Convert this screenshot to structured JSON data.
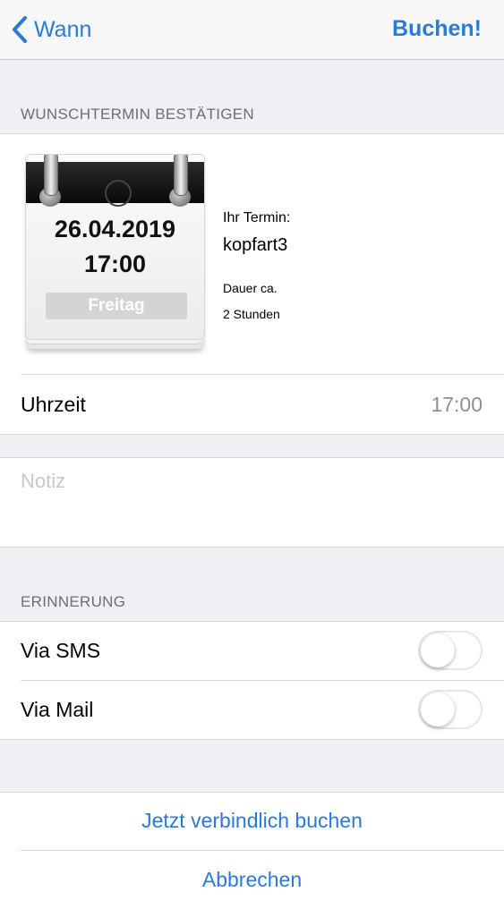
{
  "nav": {
    "back_label": "Wann",
    "action_label": "Buchen!"
  },
  "confirm_section": {
    "header": "WUNSCHTERMIN BESTÄTIGEN",
    "calendar": {
      "date": "26.04.2019",
      "time": "17:00",
      "weekday": "Freitag"
    },
    "appointment_label": "Ihr Termin:",
    "appointment_name": "kopfart3",
    "duration_label": "Dauer ca.",
    "duration_value": "2 Stunden",
    "time_row": {
      "label": "Uhrzeit",
      "value": "17:00"
    }
  },
  "note": {
    "placeholder": "Notiz"
  },
  "reminder_section": {
    "header": "ERINNERUNG",
    "items": [
      {
        "label": "Via SMS",
        "enabled": false
      },
      {
        "label": "Via Mail",
        "enabled": false
      }
    ]
  },
  "actions": {
    "book_label": "Jetzt verbindlich buchen",
    "cancel_label": "Abbrechen"
  },
  "colors": {
    "accent": "#2b7ad6",
    "background": "#efeff4",
    "secondary_text": "#8e8e93"
  }
}
